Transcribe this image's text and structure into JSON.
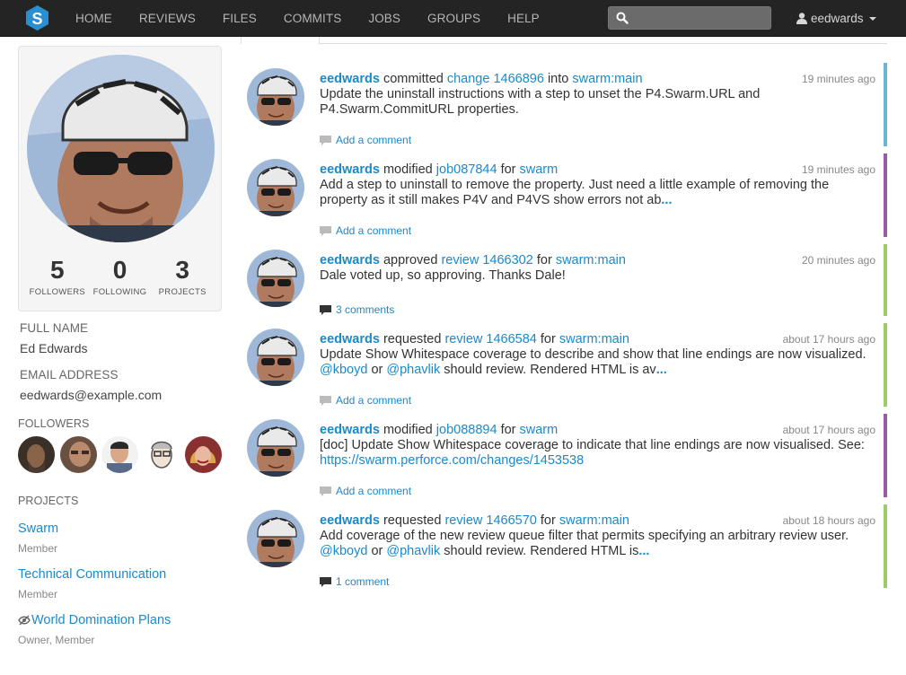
{
  "nav": {
    "items": [
      "HOME",
      "REVIEWS",
      "FILES",
      "COMMITS",
      "JOBS",
      "GROUPS",
      "HELP"
    ],
    "search_placeholder": "",
    "username": "eedwards"
  },
  "profile": {
    "stats": [
      {
        "num": "5",
        "label": "FOLLOWERS"
      },
      {
        "num": "0",
        "label": "FOLLOWING"
      },
      {
        "num": "3",
        "label": "PROJECTS"
      }
    ],
    "full_name_label": "FULL NAME",
    "full_name": "Ed Edwards",
    "email_label": "EMAIL ADDRESS",
    "email": "eedwards@example.com",
    "followers_label": "FOLLOWERS",
    "projects_label": "PROJECTS",
    "projects": [
      {
        "name": "Swarm",
        "role": "Member",
        "private": false
      },
      {
        "name": "Technical Communication",
        "role": "Member",
        "private": false
      },
      {
        "name": "World Domination Plans",
        "role": "Owner, Member",
        "private": true
      }
    ]
  },
  "activity": [
    {
      "user": "eedwards",
      "verb": "committed",
      "target": "change 1466896",
      "prep": "into",
      "project": "swarm:main",
      "time": "19 minutes ago",
      "desc": "Update the uninstall instructions with a step to unset the P4.Swarm.URL and P4.Swarm.CommitURL properties.",
      "more": "",
      "comments": "Add a comment",
      "has_comments": false,
      "color": "#6ab8d0"
    },
    {
      "user": "eedwards",
      "verb": "modified",
      "target": "job087844",
      "prep": "for",
      "project": "swarm",
      "time": "19 minutes ago",
      "desc": "Add a step to uninstall to remove the property. Just need a little example of removing the property as it still makes P4V and P4VS show errors not ab",
      "more": "...",
      "comments": "Add a comment",
      "has_comments": false,
      "color": "#9b59a8"
    },
    {
      "user": "eedwards",
      "verb": "approved",
      "target": "review 1466302",
      "prep": "for",
      "project": "swarm:main",
      "time": "20 minutes ago",
      "desc": "Dale voted up, so approving. Thanks Dale!",
      "more": "",
      "comments": "3 comments",
      "has_comments": true,
      "color": "#9ccc65"
    },
    {
      "user": "eedwards",
      "verb": "requested",
      "target": "review 1466584",
      "prep": "for",
      "project": "swarm:main",
      "time": "about 17 hours ago",
      "desc_pre": "Update Show Whitespace coverage to describe and show that line endings are now visualized.",
      "mention1": "@kboyd",
      "mid": "or",
      "mention2": "@phavlik",
      "desc_post": "should review. Rendered HTML is av",
      "more": "...",
      "comments": "Add a comment",
      "has_comments": false,
      "color": "#9ccc65"
    },
    {
      "user": "eedwards",
      "verb": "modified",
      "target": "job088894",
      "prep": "for",
      "project": "swarm",
      "time": "about 17 hours ago",
      "desc": "[doc] Update Show Whitespace coverage to indicate that line endings are now visualised. See:",
      "link": "https://swarm.perforce.com/changes/1453538",
      "more": "",
      "comments": "Add a comment",
      "has_comments": false,
      "color": "#9b59a8"
    },
    {
      "user": "eedwards",
      "verb": "requested",
      "target": "review 1466570",
      "prep": "for",
      "project": "swarm:main",
      "time": "about 18 hours ago",
      "desc_pre": "Add coverage of the new review queue filter that permits specifying an arbitrary review user.",
      "mention1": "@kboyd",
      "mid": "or",
      "mention2": "@phavlik",
      "desc_post": "should review. Rendered HTML is",
      "more": "...",
      "comments": "1 comment",
      "has_comments": true,
      "color": "#9ccc65"
    }
  ],
  "colors": {
    "accent": "#1a8ac9",
    "navbar": "#242424"
  }
}
